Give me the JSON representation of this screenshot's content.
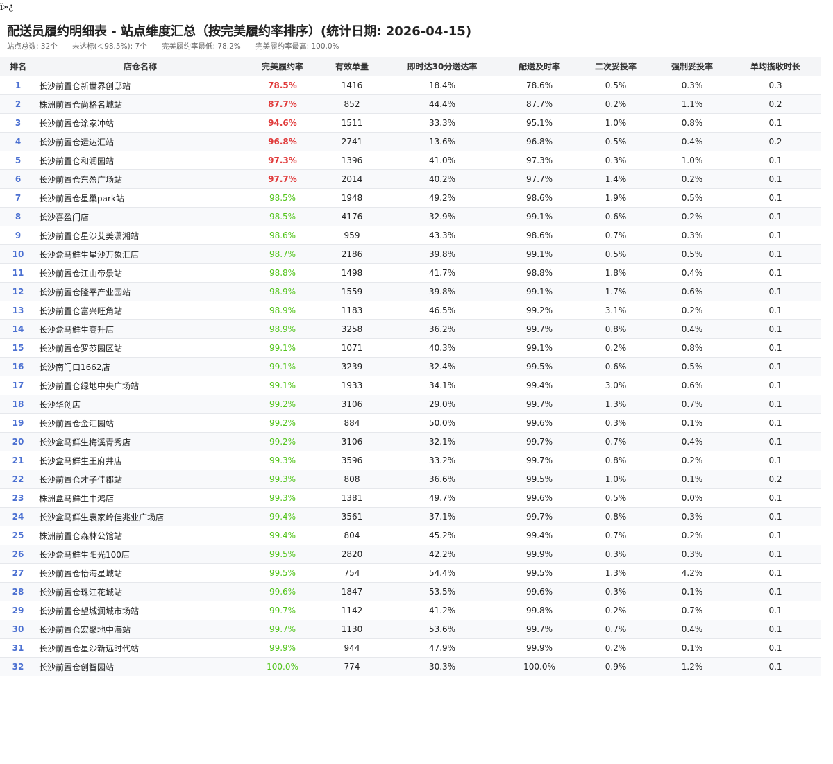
{
  "bom_text": "ï»¿",
  "title": "配送员履约明细表 - 站点维度汇总（按完美履约率排序）(统计日期: 2026-04-15)",
  "summary": [
    "站点总数: 32个",
    "未达标(＜98.5%): 7个",
    "完美履约率最低: 78.2%",
    "完美履约率最高: 100.0%"
  ],
  "colors": {
    "rate_bad": "#e03a3a",
    "rate_good": "#52c41a",
    "rank": "#4a6fd1",
    "header_bg": "#f4f5f7"
  },
  "table": {
    "headers": [
      "排名",
      "店仓名称",
      "完美履约率",
      "有效单量",
      "即时达30分送达率",
      "配送及时率",
      "二次妥投率",
      "强制妥投率",
      "单均揽收时长"
    ],
    "rows": [
      [
        "1",
        "长沙前置仓新世界创邸站",
        "78.5%",
        "1416",
        "18.4%",
        "78.6%",
        "0.5%",
        "0.3%",
        "0.3"
      ],
      [
        "2",
        "株洲前置仓尚格名城站",
        "87.7%",
        "852",
        "44.4%",
        "87.7%",
        "0.2%",
        "1.1%",
        "0.2"
      ],
      [
        "3",
        "长沙前置仓涂家冲站",
        "94.6%",
        "1511",
        "33.3%",
        "95.1%",
        "1.0%",
        "0.8%",
        "0.1"
      ],
      [
        "4",
        "长沙前置仓运达汇站",
        "96.8%",
        "2741",
        "13.6%",
        "96.8%",
        "0.5%",
        "0.4%",
        "0.2"
      ],
      [
        "5",
        "长沙前置仓和润园站",
        "97.3%",
        "1396",
        "41.0%",
        "97.3%",
        "0.3%",
        "1.0%",
        "0.1"
      ],
      [
        "6",
        "长沙前置仓东盈广场站",
        "97.7%",
        "2014",
        "40.2%",
        "97.7%",
        "1.4%",
        "0.2%",
        "0.1"
      ],
      [
        "7",
        "长沙前置仓星巢park站",
        "98.5%",
        "1948",
        "49.2%",
        "98.6%",
        "1.9%",
        "0.5%",
        "0.1"
      ],
      [
        "8",
        "长沙喜盈门店",
        "98.5%",
        "4176",
        "32.9%",
        "99.1%",
        "0.6%",
        "0.2%",
        "0.1"
      ],
      [
        "9",
        "长沙前置仓星沙艾美潇湘站",
        "98.6%",
        "959",
        "43.3%",
        "98.6%",
        "0.7%",
        "0.3%",
        "0.1"
      ],
      [
        "10",
        "长沙盒马鲜生星沙万象汇店",
        "98.7%",
        "2186",
        "39.8%",
        "99.1%",
        "0.5%",
        "0.5%",
        "0.1"
      ],
      [
        "11",
        "长沙前置仓江山帝景站",
        "98.8%",
        "1498",
        "41.7%",
        "98.8%",
        "1.8%",
        "0.4%",
        "0.1"
      ],
      [
        "12",
        "长沙前置仓隆平产业园站",
        "98.9%",
        "1559",
        "39.8%",
        "99.1%",
        "1.7%",
        "0.6%",
        "0.1"
      ],
      [
        "13",
        "长沙前置仓富兴旺角站",
        "98.9%",
        "1183",
        "46.5%",
        "99.2%",
        "3.1%",
        "0.2%",
        "0.1"
      ],
      [
        "14",
        "长沙盒马鲜生高升店",
        "98.9%",
        "3258",
        "36.2%",
        "99.7%",
        "0.8%",
        "0.4%",
        "0.1"
      ],
      [
        "15",
        "长沙前置仓罗莎园区站",
        "99.1%",
        "1071",
        "40.3%",
        "99.1%",
        "0.2%",
        "0.8%",
        "0.1"
      ],
      [
        "16",
        "长沙南门口1662店",
        "99.1%",
        "3239",
        "32.4%",
        "99.5%",
        "0.6%",
        "0.5%",
        "0.1"
      ],
      [
        "17",
        "长沙前置仓绿地中央广场站",
        "99.1%",
        "1933",
        "34.1%",
        "99.4%",
        "3.0%",
        "0.6%",
        "0.1"
      ],
      [
        "18",
        "长沙华创店",
        "99.2%",
        "3106",
        "29.0%",
        "99.7%",
        "1.3%",
        "0.7%",
        "0.1"
      ],
      [
        "19",
        "长沙前置仓金汇园站",
        "99.2%",
        "884",
        "50.0%",
        "99.6%",
        "0.3%",
        "0.1%",
        "0.1"
      ],
      [
        "20",
        "长沙盒马鲜生梅溪青秀店",
        "99.2%",
        "3106",
        "32.1%",
        "99.7%",
        "0.7%",
        "0.4%",
        "0.1"
      ],
      [
        "21",
        "长沙盒马鲜生王府井店",
        "99.3%",
        "3596",
        "33.2%",
        "99.7%",
        "0.8%",
        "0.2%",
        "0.1"
      ],
      [
        "22",
        "长沙前置仓才子佳郡站",
        "99.3%",
        "808",
        "36.6%",
        "99.5%",
        "1.0%",
        "0.1%",
        "0.2"
      ],
      [
        "23",
        "株洲盒马鲜生中鸿店",
        "99.3%",
        "1381",
        "49.7%",
        "99.6%",
        "0.5%",
        "0.0%",
        "0.1"
      ],
      [
        "24",
        "长沙盒马鲜生袁家岭佳兆业广场店",
        "99.4%",
        "3561",
        "37.1%",
        "99.7%",
        "0.8%",
        "0.3%",
        "0.1"
      ],
      [
        "25",
        "株洲前置仓森林公馆站",
        "99.4%",
        "804",
        "45.2%",
        "99.4%",
        "0.7%",
        "0.2%",
        "0.1"
      ],
      [
        "26",
        "长沙盒马鲜生阳光100店",
        "99.5%",
        "2820",
        "42.2%",
        "99.9%",
        "0.3%",
        "0.3%",
        "0.1"
      ],
      [
        "27",
        "长沙前置仓怡海星城站",
        "99.5%",
        "754",
        "54.4%",
        "99.5%",
        "1.3%",
        "4.2%",
        "0.1"
      ],
      [
        "28",
        "长沙前置仓珠江花城站",
        "99.6%",
        "1847",
        "53.5%",
        "99.6%",
        "0.3%",
        "0.1%",
        "0.1"
      ],
      [
        "29",
        "长沙前置仓望城润城市场站",
        "99.7%",
        "1142",
        "41.2%",
        "99.8%",
        "0.2%",
        "0.7%",
        "0.1"
      ],
      [
        "30",
        "长沙前置仓宏聚地中海站",
        "99.7%",
        "1130",
        "53.6%",
        "99.7%",
        "0.7%",
        "0.4%",
        "0.1"
      ],
      [
        "31",
        "长沙前置仓星沙新远时代站",
        "99.9%",
        "944",
        "47.9%",
        "99.9%",
        "0.2%",
        "0.1%",
        "0.1"
      ],
      [
        "32",
        "长沙前置仓创智园站",
        "100.0%",
        "774",
        "30.3%",
        "100.0%",
        "0.9%",
        "1.2%",
        "0.1"
      ]
    ]
  }
}
